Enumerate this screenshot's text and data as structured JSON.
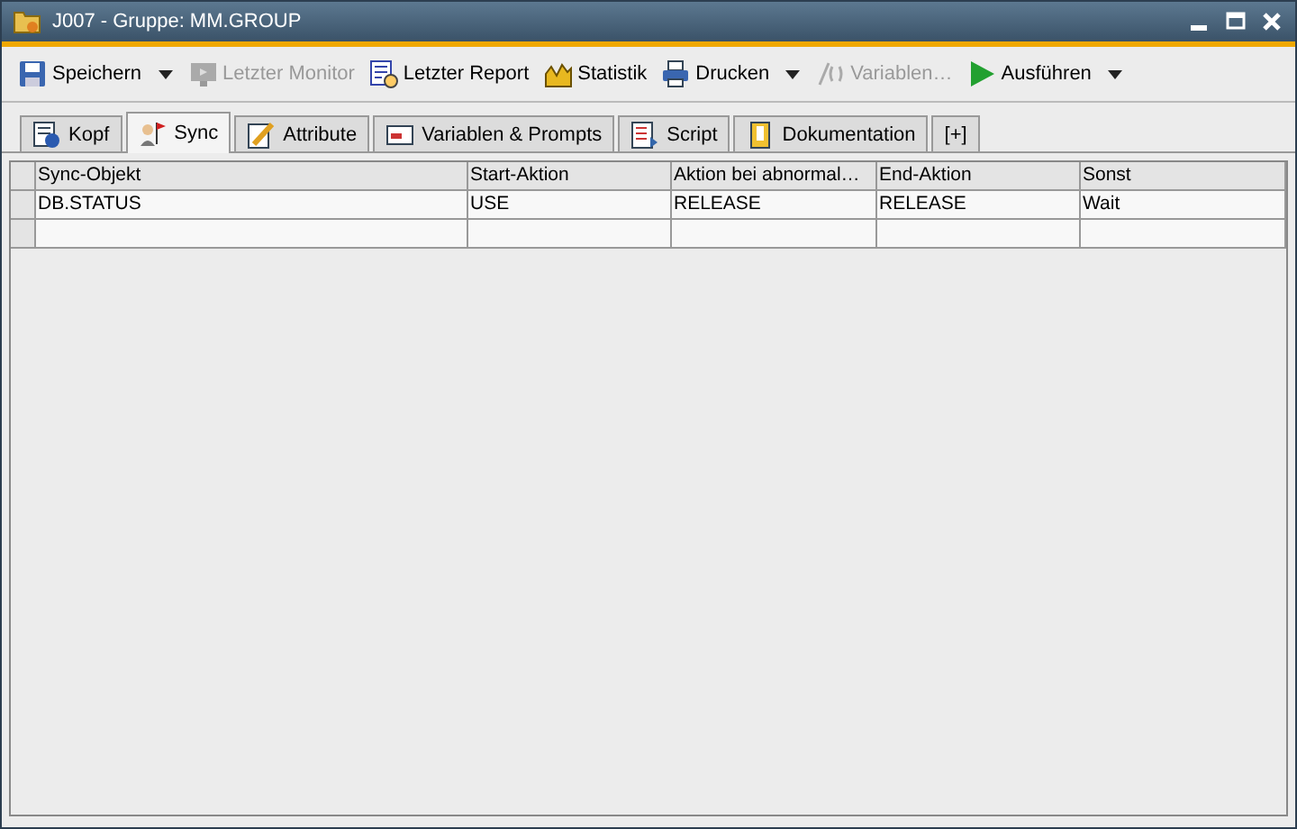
{
  "window": {
    "title": "J007 - Gruppe: MM.GROUP"
  },
  "toolbar": [
    {
      "label": "Speichern",
      "disabled": false,
      "dropdown": true
    },
    {
      "label": "Letzter Monitor",
      "disabled": true,
      "dropdown": false
    },
    {
      "label": "Letzter Report",
      "disabled": false,
      "dropdown": false
    },
    {
      "label": "Statistik",
      "disabled": false,
      "dropdown": false
    },
    {
      "label": "Drucken",
      "disabled": false,
      "dropdown": true
    },
    {
      "label": "Variablen…",
      "disabled": true,
      "dropdown": false
    },
    {
      "label": "Ausführen",
      "disabled": false,
      "dropdown": true
    }
  ],
  "tabs": [
    {
      "label": "Kopf",
      "selected": false
    },
    {
      "label": "Sync",
      "selected": true
    },
    {
      "label": "Attribute",
      "selected": false
    },
    {
      "label": "Variablen & Prompts",
      "selected": false
    },
    {
      "label": "Script",
      "selected": false
    },
    {
      "label": "Dokumentation",
      "selected": false
    },
    {
      "label": "[+]",
      "selected": false
    }
  ],
  "table": {
    "columns": [
      "Sync-Objekt",
      "Start-Aktion",
      "Aktion bei abnormal…",
      "End-Aktion",
      "Sonst"
    ],
    "rows": [
      [
        "DB.STATUS",
        "USE",
        "RELEASE",
        "RELEASE",
        "Wait"
      ]
    ]
  }
}
